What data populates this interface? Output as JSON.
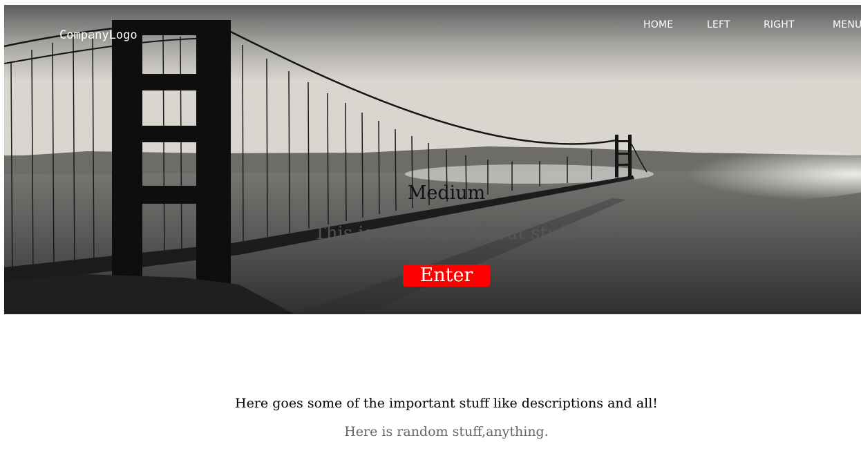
{
  "header": {
    "logo": "CompanyLogo",
    "nav": [
      "HOME",
      "LEFT",
      "RIGHT",
      "MENU"
    ]
  },
  "hero": {
    "title": "Medium",
    "subtitle": "This is some text about stuff!",
    "button_label": "Enter",
    "button_color": "#ff0000"
  },
  "content": {
    "title": "Here goes some of the important stuff like descriptions and all!",
    "subtitle": "Here is random stuff,anything."
  }
}
